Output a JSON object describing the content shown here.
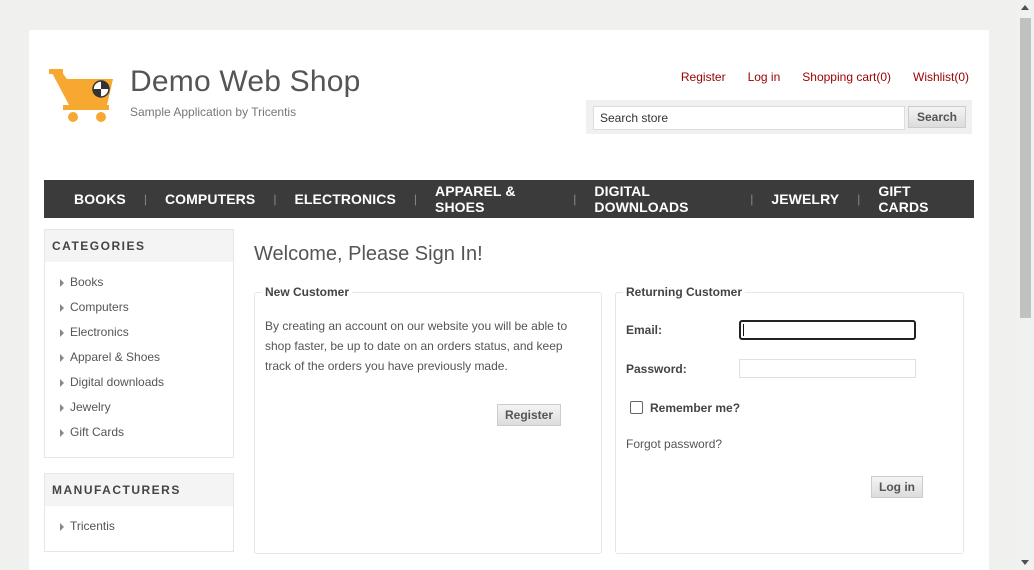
{
  "header": {
    "title": "Demo Web Shop",
    "subtitle": "Sample Application by Tricentis",
    "links": [
      "Register",
      "Log in",
      "Shopping cart(0)",
      "Wishlist(0)"
    ],
    "search_value": "Search store",
    "search_button": "Search",
    "logo_icon": "shopping-cart-icon",
    "accent_color": "#990000",
    "logo_color": "#f7a831"
  },
  "menu": {
    "items": [
      "BOOKS",
      "COMPUTERS",
      "ELECTRONICS",
      "APPAREL & SHOES",
      "DIGITAL DOWNLOADS",
      "JEWELRY",
      "GIFT CARDS"
    ],
    "separator": "|"
  },
  "sidebar": {
    "categories_title": "CATEGORIES",
    "categories": [
      "Books",
      "Computers",
      "Electronics",
      "Apparel & Shoes",
      "Digital downloads",
      "Jewelry",
      "Gift Cards"
    ],
    "manufacturers_title": "MANUFACTURERS",
    "manufacturers": [
      "Tricentis"
    ]
  },
  "main": {
    "title": "Welcome, Please Sign In!",
    "new_customer": {
      "title": "New Customer",
      "text": "By creating an account on our website you will be able to shop faster, be up to date on an orders status, and keep track of the orders you have previously made.",
      "register_button": "Register"
    },
    "returning_customer": {
      "title": "Returning Customer",
      "email_label": "Email:",
      "email_value": "",
      "password_label": "Password:",
      "password_value": "",
      "remember_label": "Remember me?",
      "remember_checked": false,
      "forgot_link": "Forgot password?",
      "login_button": "Log in"
    }
  }
}
